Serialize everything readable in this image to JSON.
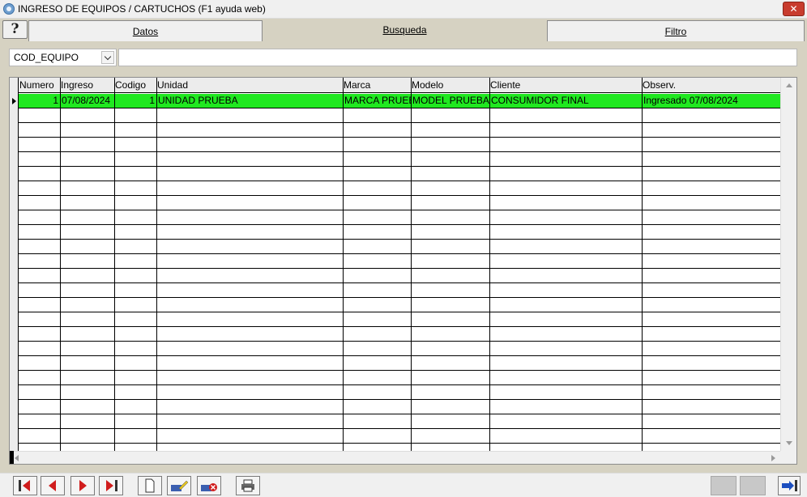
{
  "window": {
    "title": "INGRESO DE EQUIPOS / CARTUCHOS (F1 ayuda web)",
    "close_symbol": "✕",
    "app_icon": "app-logo-icon"
  },
  "tabs": [
    {
      "label": "Datos",
      "active": false
    },
    {
      "label": "Busqueda",
      "active": true
    },
    {
      "label": "Filtro",
      "active": false
    }
  ],
  "help": {
    "symbol": "?",
    "icon": "help-icon"
  },
  "search": {
    "field_value": "COD_EQUIPO",
    "input_value": ""
  },
  "table": {
    "columns": [
      "Numero",
      "Ingreso",
      "Codigo",
      "Unidad",
      "Marca",
      "Modelo",
      "Cliente",
      "Observ."
    ],
    "rows": [
      [
        "1",
        "07/08/2024",
        "1",
        "UNIDAD PRUEBA",
        "MARCA PRUEBA",
        "MODEL PRUEBA",
        "CONSUMIDOR FINAL",
        "Ingresado 07/08/2024"
      ]
    ],
    "selected_row_color": "#20e820",
    "empty_row_count": 23
  },
  "toolbar": {
    "buttons": [
      "first-record-icon",
      "previous-record-icon",
      "next-record-icon",
      "last-record-icon",
      "new-record-icon",
      "edit-record-icon",
      "delete-record-icon",
      "print-icon",
      "exit-icon"
    ]
  }
}
